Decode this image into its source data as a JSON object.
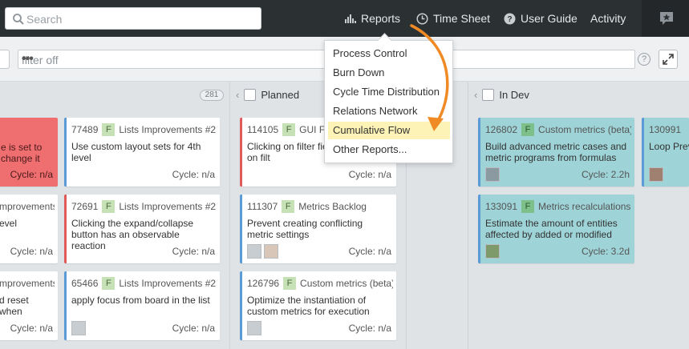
{
  "topbar": {
    "search_placeholder": "Search",
    "nav": {
      "reports": "Reports",
      "timesheet": "Time Sheet",
      "userguide": "User Guide",
      "activity": "Activity"
    }
  },
  "filter": {
    "placeholder": "filter off",
    "more": "•••",
    "help": "?"
  },
  "columns": {
    "first": {
      "count": "281"
    },
    "planned": {
      "label": "Planned"
    },
    "indev": {
      "label": "In Dev"
    }
  },
  "reports_menu": {
    "items": [
      "Process Control",
      "Burn Down",
      "Cycle Time Distribution",
      "Relations Network",
      "Cumulative Flow",
      "Other Reports..."
    ],
    "active_index": 4
  },
  "cards": {
    "c0a": {
      "title": "e is set to\nchange it",
      "cycle": "Cycle: n/a"
    },
    "c0b": {
      "feature": "mprovements #2 (",
      "title": "evel",
      "cycle": "Cycle: n/a"
    },
    "c0c": {
      "feature": "mprovements #2 (",
      "title": "d reset when",
      "cycle": "Cycle: n/a"
    },
    "c1a": {
      "id": "77489",
      "badge": "F",
      "feature": "Lists Improvements #2 (",
      "title": "Use custom layout sets for 4th level",
      "cycle": "Cycle: n/a"
    },
    "c1b": {
      "id": "72691",
      "badge": "F",
      "feature": "Lists Improvements #2 (",
      "title": "Clicking the expand/collapse button has an observable reaction",
      "cycle": "Cycle: n/a"
    },
    "c1c": {
      "id": "65466",
      "badge": "F",
      "feature": "Lists Improvements #2 (",
      "title": "apply focus from board in the list",
      "cycle": "Cycle: n/a"
    },
    "c2a": {
      "id": "114105",
      "badge": "F",
      "feature": "GUI Fi",
      "title": "Clicking on filter fie should focus on filt",
      "cycle": "Cycle: n/a"
    },
    "c2b": {
      "id": "111307",
      "badge": "F",
      "feature": "Metrics Backlog",
      "title": "Prevent creating conflicting metric settings",
      "cycle": "Cycle: n/a"
    },
    "c2c": {
      "id": "126796",
      "badge": "F",
      "feature": "Custom metrics (beta)",
      "title": "Optimize the instantiation of custom metrics for execution",
      "cycle": "Cycle: n/a"
    },
    "c3a": {
      "id": "126802",
      "badge": "F",
      "feature": "Custom metrics (beta)",
      "title": "Build advanced metric cases and metric programs from formulas",
      "cycle": "Cycle: 2.2h"
    },
    "c3b": {
      "id": "133091",
      "badge": "F",
      "feature": "Metrics recalculations i",
      "title": "Estimate the amount of entities affected by added or modified",
      "cycle": "Cycle: 3.2d"
    },
    "c4a": {
      "id": "130991",
      "title": "Loop Prev"
    }
  },
  "colors": {
    "topbar": "#2b3033",
    "highlight": "#fdf3b6",
    "arrow": "#f08a24",
    "teal_card": "#9ed3d7",
    "red_card": "#ef6e70"
  }
}
